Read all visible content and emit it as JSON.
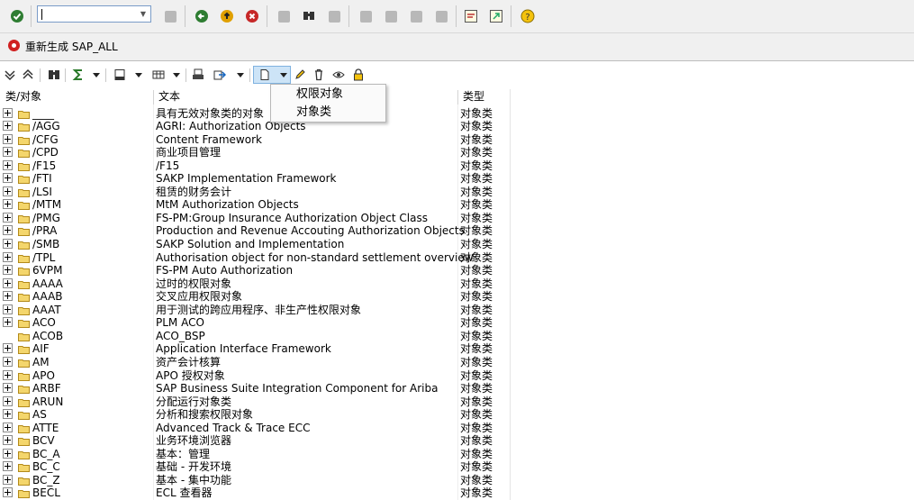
{
  "command_field": {
    "value": ""
  },
  "toolbar_icons": [
    "enter-icon",
    "back-icon",
    "exit-icon",
    "cancel-icon",
    "save-icon",
    "print-icon",
    "find-icon",
    "find-next-icon",
    "first-page-icon",
    "previous-page-icon",
    "next-page-icon",
    "last-page-icon",
    "create-session-icon",
    "shortcut-icon",
    "help-icon"
  ],
  "title": "重新生成 SAP_ALL",
  "app_toolbar_icons": [
    "expand-all-icon",
    "collapse-all-icon",
    "find-icon",
    "sum-icon",
    "print-icon",
    "export-icon",
    "layout-icon",
    "new-document-icon",
    "edit-icon",
    "delete-icon",
    "display-icon",
    "lock-icon"
  ],
  "table": {
    "headers": {
      "object": "类/对象",
      "text": "文本",
      "type": "类型"
    },
    "rows": [
      {
        "object": "____",
        "text": "具有无效对象类的对象",
        "type": "对象类",
        "expandable": true
      },
      {
        "object": "/AGG",
        "text": "AGRI: Authorization Objects",
        "type": "对象类",
        "expandable": true
      },
      {
        "object": "/CFG",
        "text": "Content Framework",
        "type": "对象类",
        "expandable": true
      },
      {
        "object": "/CPD",
        "text": "商业项目管理",
        "type": "对象类",
        "expandable": true
      },
      {
        "object": "/F15",
        "text": "/F15",
        "type": "对象类",
        "expandable": true
      },
      {
        "object": "/FTI",
        "text": "SAKP Implementation Framework",
        "type": "对象类",
        "expandable": true
      },
      {
        "object": "/LSI",
        "text": "租赁的财务会计",
        "type": "对象类",
        "expandable": true
      },
      {
        "object": "/MTM",
        "text": "MtM Authorization Objects",
        "type": "对象类",
        "expandable": true
      },
      {
        "object": "/PMG",
        "text": "FS-PM:Group Insurance Authorization Object Class",
        "type": "对象类",
        "expandable": true
      },
      {
        "object": "/PRA",
        "text": "Production and Revenue Accouting Authorization Objects",
        "type": "对象类",
        "expandable": true
      },
      {
        "object": "/SMB",
        "text": "SAKP Solution and Implementation",
        "type": "对象类",
        "expandable": true
      },
      {
        "object": "/TPL",
        "text": "Authorisation object for non-standard settlement overview",
        "type": "对象类",
        "expandable": true
      },
      {
        "object": "6VPM",
        "text": "FS-PM Auto Authorization",
        "type": "对象类",
        "expandable": true
      },
      {
        "object": "AAAA",
        "text": "过时的权限对象",
        "type": "对象类",
        "expandable": true
      },
      {
        "object": "AAAB",
        "text": "交叉应用权限对象",
        "type": "对象类",
        "expandable": true
      },
      {
        "object": "AAAT",
        "text": "用于测试的跨应用程序、非生产性权限对象",
        "type": "对象类",
        "expandable": true
      },
      {
        "object": "ACO",
        "text": "PLM ACO",
        "type": "对象类",
        "expandable": true
      },
      {
        "object": "ACOB",
        "text": "ACO_BSP",
        "type": "对象类",
        "expandable": false
      },
      {
        "object": "AIF",
        "text": "Application Interface Framework",
        "type": "对象类",
        "expandable": true
      },
      {
        "object": "AM",
        "text": "资产会计核算",
        "type": "对象类",
        "expandable": true
      },
      {
        "object": "APO",
        "text": "APO 授权对象",
        "type": "对象类",
        "expandable": true
      },
      {
        "object": "ARBF",
        "text": "SAP Business Suite Integration Component for Ariba",
        "type": "对象类",
        "expandable": true
      },
      {
        "object": "ARUN",
        "text": "分配运行对象类",
        "type": "对象类",
        "expandable": true
      },
      {
        "object": "AS",
        "text": "分析和搜索权限对象",
        "type": "对象类",
        "expandable": true
      },
      {
        "object": "ATTE",
        "text": "Advanced Track & Trace ECC",
        "type": "对象类",
        "expandable": true
      },
      {
        "object": "BCV",
        "text": "业务环境浏览器",
        "type": "对象类",
        "expandable": true
      },
      {
        "object": "BC_A",
        "text": "基本：管理",
        "type": "对象类",
        "expandable": true
      },
      {
        "object": "BC_C",
        "text": "基础 -  开发环境",
        "type": "对象类",
        "expandable": true
      },
      {
        "object": "BC_Z",
        "text": "基本 - 集中功能",
        "type": "对象类",
        "expandable": true
      },
      {
        "object": "BECL",
        "text": "ECL 查看器",
        "type": "对象类",
        "expandable": true
      }
    ]
  },
  "menu": {
    "items": [
      "权限对象",
      "对象类"
    ]
  },
  "colors": {
    "folder": "#f4d66c",
    "folder_border": "#b38a1a",
    "menu_highlight": "#cde4f7"
  }
}
